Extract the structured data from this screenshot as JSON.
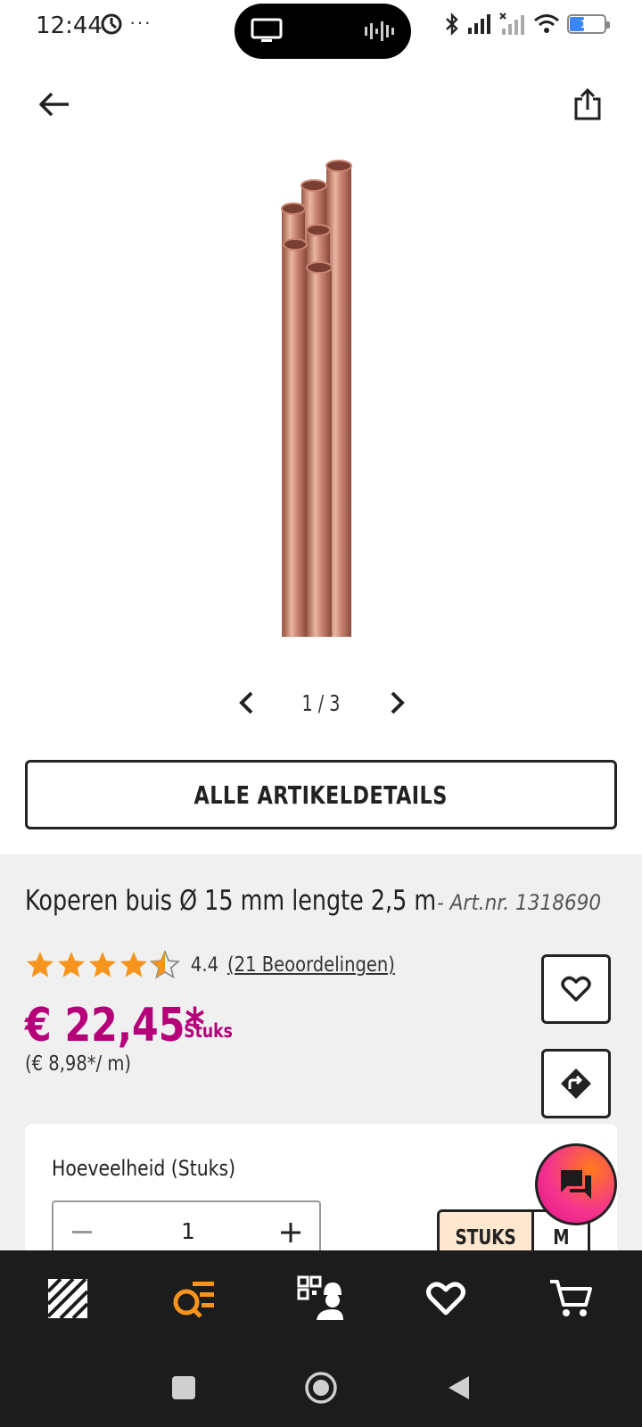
{
  "status_bar": {
    "time": "12:44",
    "dots": "···",
    "battery": "11"
  },
  "header": {
    "back_icon": "arrow-left-icon",
    "share_icon": "share-icon"
  },
  "gallery": {
    "current": 1,
    "total": 3,
    "counter": "1 / 3",
    "image": "copper-pipes-image"
  },
  "details_button": {
    "label": "ALLE ARTIKELDETAILS"
  },
  "product": {
    "title": "Koperen buis Ø 15 mm lengte 2,5 m",
    "article_number": "- Art.nr. 1318690",
    "rating": 4.4,
    "rating_text": "4.4",
    "reviews_link": "(21 Beoordelingen)",
    "price": "€ 22,45*",
    "price_unit": "/ Stuks",
    "price_per_meter": "(€ 8,98*/ m)"
  },
  "quantity": {
    "label": "Hoeveelheid (Stuks)",
    "value": "1",
    "unit_options": [
      "STUKS",
      "M"
    ],
    "selected_unit": "STUKS"
  },
  "bottom_nav": {
    "items": [
      "home-logo-icon",
      "search-list-icon",
      "scan-advisor-icon",
      "favorites-icon",
      "cart-icon"
    ],
    "active": "search-list-icon"
  },
  "colors": {
    "price": "#b5007a",
    "accent": "#f7941d",
    "unit_active_bg": "#fde7cf",
    "star": "#f7941d",
    "nav_bg": "#1c1c1c"
  }
}
